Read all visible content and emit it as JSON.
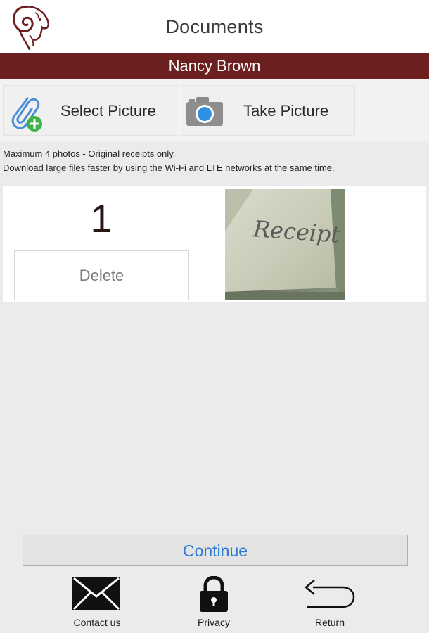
{
  "header": {
    "title": "Documents"
  },
  "user": {
    "name": "Nancy Brown"
  },
  "actions": {
    "select_label": "Select Picture",
    "take_label": "Take Picture",
    "select_icon": "paperclip-add-icon",
    "take_icon": "camera-icon"
  },
  "info": {
    "line1": "Maximum 4 photos - Original receipts only.",
    "line2": "Download large files faster by using the Wi-Fi and LTE networks at the same time."
  },
  "photos": [
    {
      "number": "1",
      "delete_label": "Delete",
      "thumb_handwriting": "Receipt"
    }
  ],
  "continue_label": "Continue",
  "footer": [
    {
      "label": "Contact us",
      "icon": "envelope-icon"
    },
    {
      "label": "Privacy",
      "icon": "lock-icon"
    },
    {
      "label": "Return",
      "icon": "return-arrow-icon"
    }
  ],
  "colors": {
    "banner": "#6b1f1f",
    "link_blue": "#2a7ad6",
    "background": "#ebebeb"
  }
}
